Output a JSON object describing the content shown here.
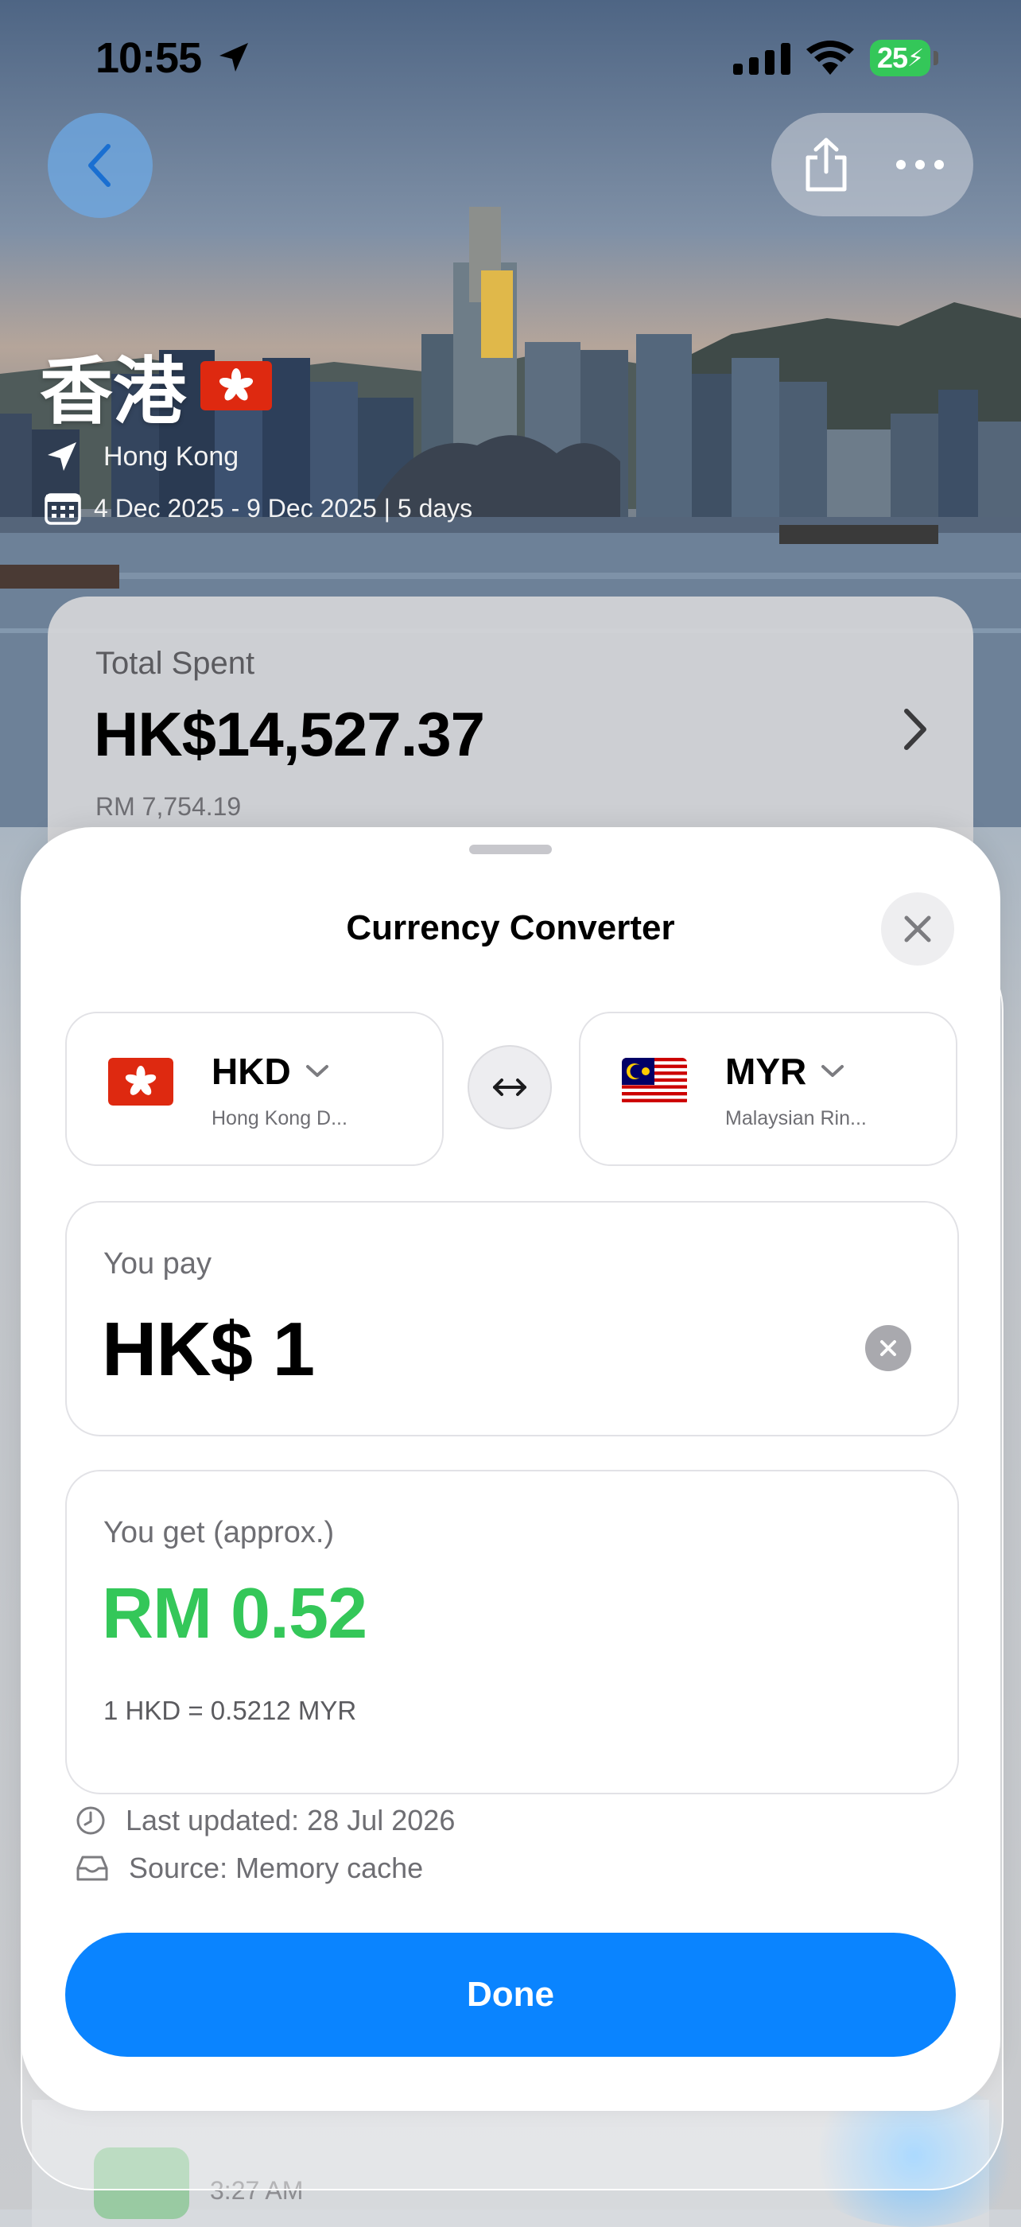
{
  "status_bar": {
    "time": "10:55",
    "battery": "25"
  },
  "icons": {
    "back": "chevron-left-icon",
    "share": "share-icon",
    "more": "more-horizontal-icon",
    "location": "location-arrow-icon",
    "calendar": "calendar-icon",
    "close": "close-icon",
    "swap": "swap-horizontal-icon",
    "clear": "clear-circle-icon",
    "clock": "clock-icon",
    "source": "tray-icon",
    "chevron_down": "chevron-down-icon",
    "chevron_right": "chevron-right-icon"
  },
  "trip": {
    "title": "香港",
    "location": "Hong Kong",
    "dates": "4 Dec 2025 - 9 Dec 2025 | 5 days"
  },
  "total_spent": {
    "label": "Total Spent",
    "value": "HK$14,527.37",
    "converted": "RM 7,754.19"
  },
  "converter": {
    "title": "Currency Converter",
    "from": {
      "code": "HKD",
      "name": "Hong Kong D..."
    },
    "to": {
      "code": "MYR",
      "name": "Malaysian Rin..."
    },
    "pay_label": "You pay",
    "pay_value": "HK$ 1",
    "get_label": "You get (approx.)",
    "get_value": "RM 0.52",
    "rate": "1 HKD = 0.5212 MYR",
    "last_updated": "Last updated: 28 Jul 2026",
    "source": "Source: Memory cache",
    "done_label": "Done"
  },
  "background_peek": {
    "time": "3:27 AM"
  },
  "colors": {
    "accent": "#0a84ff",
    "positive": "#34c759",
    "battery": "#34c759"
  }
}
